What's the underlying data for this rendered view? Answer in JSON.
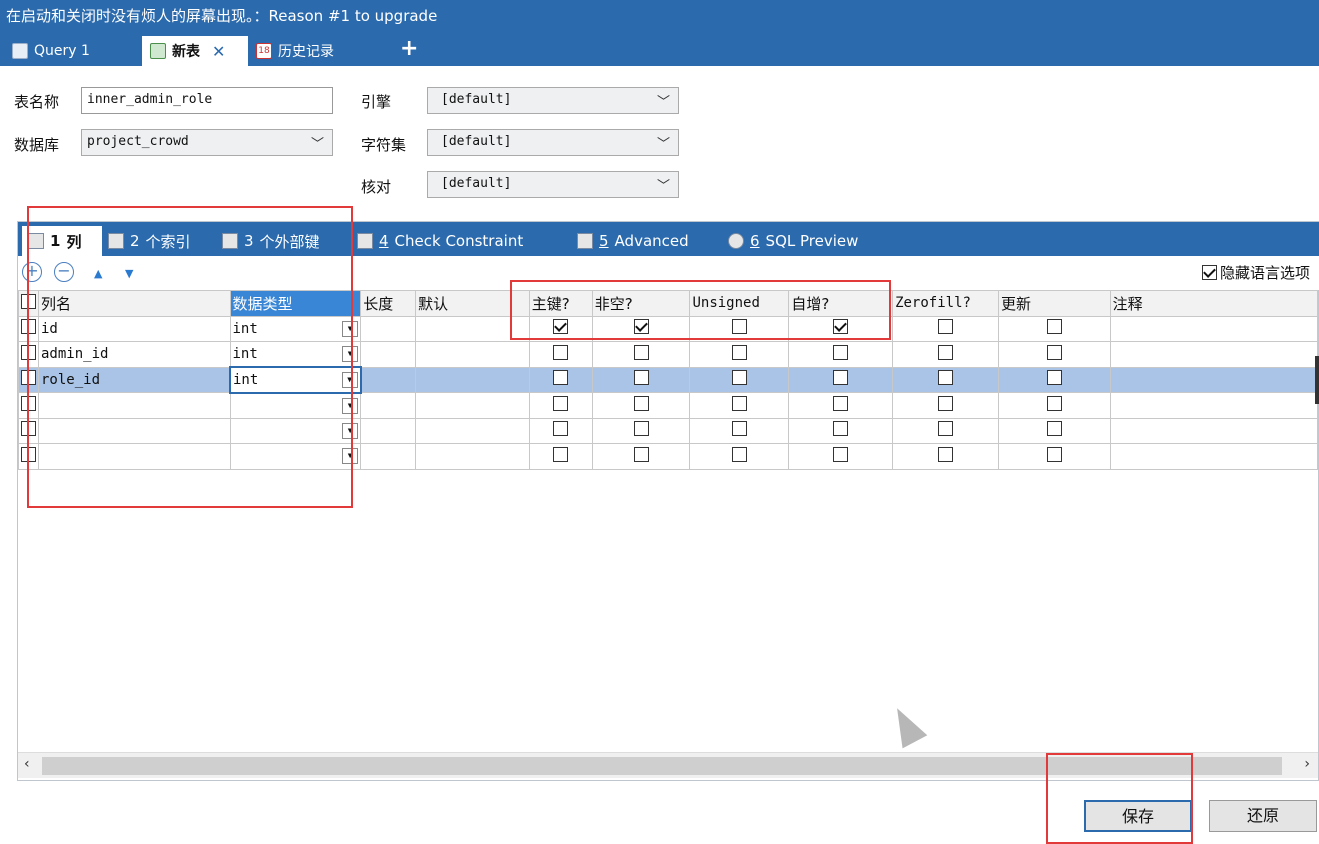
{
  "window": {
    "title": "在启动和关闭时没有烦人的屏幕出现。：Reason #1 to upgrade"
  },
  "tabs": [
    {
      "label": "Query 1",
      "icon": "query-icon"
    },
    {
      "label": "新表",
      "icon": "new-table-icon",
      "active": true,
      "close": "✕"
    },
    {
      "label": "历史记录",
      "icon": "history-icon",
      "badge": "18"
    }
  ],
  "add_tab": "+",
  "form": {
    "table_name_label": "表名称",
    "table_name_value": "inner_admin_role",
    "database_label": "数据库",
    "database_value": "project_crowd",
    "engine_label": "引擎",
    "engine_value": "[default]",
    "charset_label": "字符集",
    "charset_value": "[default]",
    "collation_label": "核对",
    "collation_value": "[default]"
  },
  "subtabs": [
    {
      "num": "1",
      "label": "列"
    },
    {
      "num": "2",
      "label": "个索引"
    },
    {
      "num": "3",
      "label": "个外部键"
    },
    {
      "num": "4",
      "label": "Check Constraint"
    },
    {
      "num": "5",
      "label": "Advanced"
    },
    {
      "num": "6",
      "label": "SQL Preview"
    }
  ],
  "toolbar": {
    "add": "+",
    "remove": "−",
    "up": "▲",
    "down": "▼",
    "hide_lang": "隐藏语言选项"
  },
  "grid": {
    "headers": [
      "列名",
      "数据类型",
      "长度",
      "默认",
      "主键?",
      "非空?",
      "Unsigned",
      "自增?",
      "Zerofill?",
      "更新",
      "注释"
    ],
    "rows": [
      {
        "name": "id",
        "type": "int",
        "pk": true,
        "nn": true,
        "unsigned": false,
        "ai": true,
        "zf": false,
        "upd": false
      },
      {
        "name": "admin_id",
        "type": "int",
        "pk": false,
        "nn": false,
        "unsigned": false,
        "ai": false,
        "zf": false,
        "upd": false
      },
      {
        "name": "role_id",
        "type": "int",
        "pk": false,
        "nn": false,
        "unsigned": false,
        "ai": false,
        "zf": false,
        "upd": false,
        "selected": true
      },
      {
        "name": "",
        "type": "",
        "pk": false,
        "nn": false,
        "unsigned": false,
        "ai": false,
        "zf": false,
        "upd": false
      },
      {
        "name": "",
        "type": "",
        "pk": false,
        "nn": false,
        "unsigned": false,
        "ai": false,
        "zf": false,
        "upd": false
      },
      {
        "name": "",
        "type": "",
        "pk": false,
        "nn": false,
        "unsigned": false,
        "ai": false,
        "zf": false,
        "upd": false
      }
    ]
  },
  "scroll": {
    "left": "‹",
    "right": "›"
  },
  "buttons": {
    "save": "保存",
    "revert": "还原"
  },
  "colors": {
    "accent": "#2a6aad",
    "highlight": "#e23a3a",
    "selected_row": "#a9c4e6"
  }
}
